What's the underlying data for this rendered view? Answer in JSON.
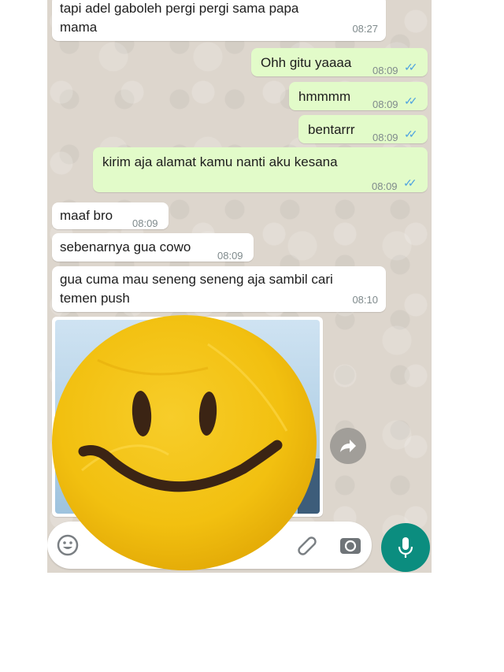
{
  "messages": [
    {
      "text_line1": "tapi adel gaboleh pergi pergi sama papa",
      "text_line2": "mama",
      "time": "08:27"
    },
    {
      "text": "Ohh gitu yaaaa",
      "time": "08:09"
    },
    {
      "text": "hmmmm",
      "time": "08:09"
    },
    {
      "text": "bentarrr",
      "time": "08:09"
    },
    {
      "text": "kirim aja alamat kamu nanti aku kesana",
      "time": "08:09"
    },
    {
      "text": "maaf bro",
      "time": "08:09"
    },
    {
      "text": "sebenarnya gua cowo",
      "time": "08:09"
    },
    {
      "text_line1": "gua cuma mau seneng seneng aja sambil cari",
      "text_line2": "temen push",
      "time": "08:10"
    }
  ],
  "icons": {
    "ticks": "double-check-icon",
    "forward": "forward-icon",
    "emoji": "emoji-icon",
    "attach": "paperclip-icon",
    "camera": "camera-icon",
    "mic": "microphone-icon",
    "sticker": "smiley-face-sticker"
  },
  "colors": {
    "incoming": "#ffffff",
    "outgoing": "#e2fbc9",
    "read_ticks": "#4fa3e0",
    "mic_button": "#0b8d7f",
    "sticker": "#f4c20d"
  }
}
